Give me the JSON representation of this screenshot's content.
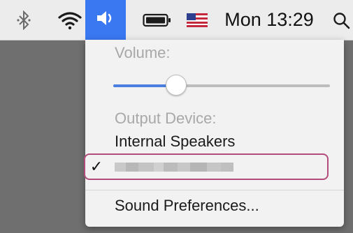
{
  "menubar": {
    "icons": {
      "bluetooth": "bluetooth-icon",
      "wifi": "wifi-icon",
      "volume": "speaker-icon",
      "battery": "battery-icon",
      "flag": "us-flag-icon",
      "search": "search-icon"
    },
    "clock": "Mon 13:29",
    "accent": "#3a78f2"
  },
  "menu": {
    "volume_label": "Volume:",
    "volume_level": 0.29,
    "output_label": "Output Device:",
    "devices": [
      {
        "name": "Internal Speakers",
        "selected": false
      },
      {
        "name": "",
        "selected": true,
        "name_obscured": true
      }
    ],
    "check_symbol": "✓",
    "preferences_label": "Sound Preferences..."
  }
}
